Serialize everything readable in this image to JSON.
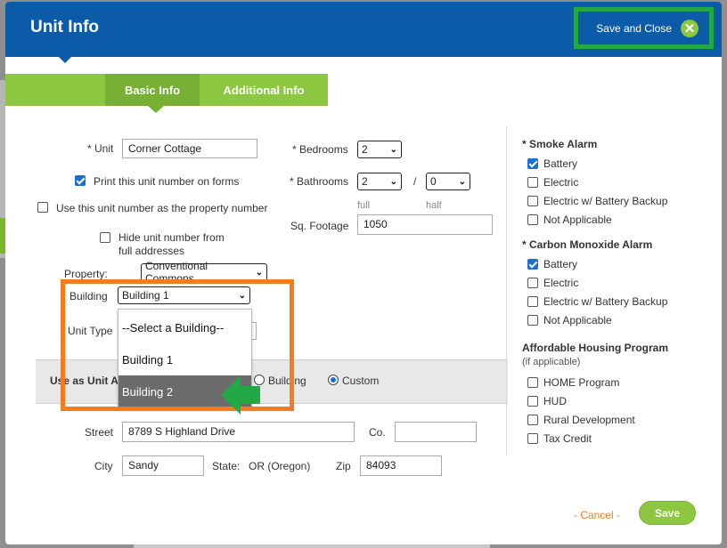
{
  "header": {
    "title": "Unit Info",
    "save_close_label": "Save and Close",
    "close_glyph": "✕"
  },
  "tabs": [
    {
      "label": "Basic Info",
      "active": true
    },
    {
      "label": "Additional Info",
      "active": false
    }
  ],
  "unit": {
    "label": "* Unit",
    "value": "Corner Cottage",
    "print_label": "Print this unit number on forms",
    "print_checked": true,
    "use_as_property_label": "Use this unit number as the property number",
    "use_as_property_checked": false,
    "hide_label_1": "Hide unit number from",
    "hide_label_2": "full addresses",
    "hide_checked": false
  },
  "property": {
    "label": "Property:",
    "value": "Conventional Commons"
  },
  "building": {
    "label": "Building",
    "value": "Building 1",
    "options": [
      "--Select a Building--",
      "Building 1",
      "Building 2"
    ],
    "highlighted": "Building 2"
  },
  "unit_type": {
    "label": "Unit Type"
  },
  "use_as": {
    "label_visible": "Use as Unit A",
    "option_building": "Building",
    "option_custom": "Custom",
    "selected": "Custom"
  },
  "bedrooms": {
    "label": "* Bedrooms",
    "value": "2"
  },
  "bathrooms": {
    "label": "* Bathrooms",
    "full": "2",
    "half": "0",
    "separator": "/",
    "full_label": "full",
    "half_label": "half"
  },
  "sq_footage": {
    "label": "Sq. Footage",
    "value": "1050"
  },
  "address": {
    "street_label": "Street",
    "street": "8789 S Highland Drive",
    "co_label": "Co.",
    "co": "",
    "city_label": "City",
    "city": "Sandy",
    "state_label": "State:",
    "state": "OR (Oregon)",
    "zip_label": "Zip",
    "zip": "84093"
  },
  "smoke_alarm": {
    "title": "* Smoke Alarm",
    "options": [
      {
        "label": "Battery",
        "checked": true
      },
      {
        "label": "Electric",
        "checked": false
      },
      {
        "label": "Electric w/ Battery Backup",
        "checked": false
      },
      {
        "label": "Not Applicable",
        "checked": false
      }
    ]
  },
  "co_alarm": {
    "title": "* Carbon Monoxide Alarm",
    "options": [
      {
        "label": "Battery",
        "checked": true
      },
      {
        "label": "Electric",
        "checked": false
      },
      {
        "label": "Electric w/ Battery Backup",
        "checked": false
      },
      {
        "label": "Not Applicable",
        "checked": false
      }
    ]
  },
  "affordable": {
    "title": "Affordable Housing Program",
    "subtitle": "(if applicable)",
    "options": [
      {
        "label": "HOME Program",
        "checked": false
      },
      {
        "label": "HUD",
        "checked": false
      },
      {
        "label": "Rural Development",
        "checked": false
      },
      {
        "label": "Tax Credit",
        "checked": false
      }
    ]
  },
  "footer": {
    "cancel_label": "- Cancel -",
    "save_label": "Save"
  },
  "colors": {
    "header_blue": "#0b5ba8",
    "accent_green": "#8dc63f",
    "highlight_orange": "#f47c20",
    "annotation_green": "#22a844"
  },
  "icons": [
    "close-icon",
    "chevron-down-icon",
    "check-icon",
    "pointer-arrow-icon"
  ]
}
